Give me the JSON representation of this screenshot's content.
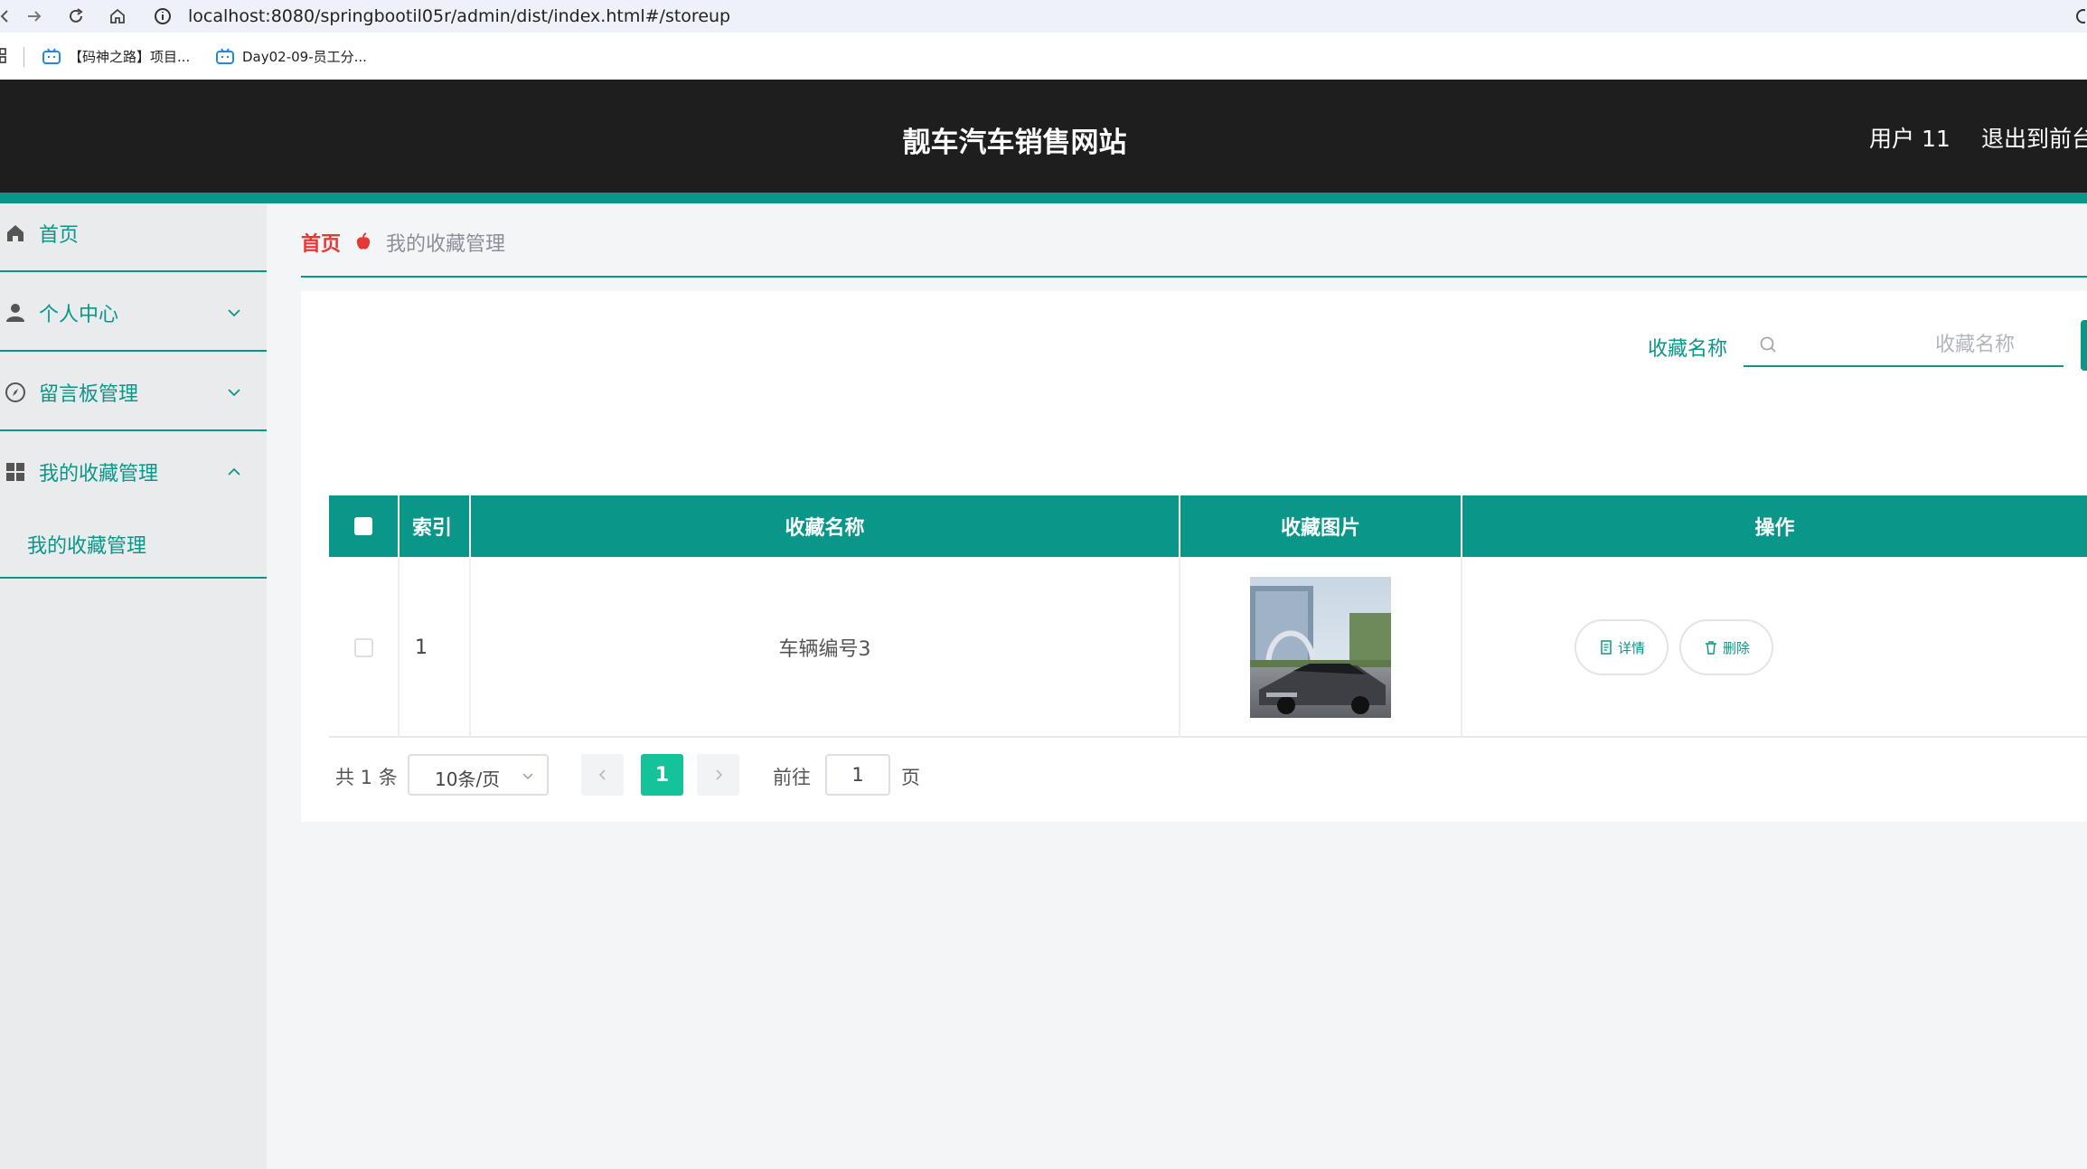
{
  "browser": {
    "url": "localhost:8080/springbootil05r/admin/dist/index.html#/storeup",
    "bookmarks": [
      {
        "label": "【码神之路】项目..."
      },
      {
        "label": "Day02-09-员工分..."
      }
    ]
  },
  "header": {
    "title": "靓车汽车销售网站",
    "user": "用户 11",
    "logout": "退出到前台"
  },
  "sidebar": {
    "items": [
      {
        "label": "首页",
        "icon": "home-icon"
      },
      {
        "label": "个人中心",
        "icon": "user-icon"
      },
      {
        "label": "留言板管理",
        "icon": "compass-icon"
      },
      {
        "label": "我的收藏管理",
        "icon": "grid-icon",
        "expanded": true,
        "children": [
          {
            "label": "我的收藏管理"
          }
        ]
      }
    ]
  },
  "breadcrumb": {
    "home": "首页",
    "current": "我的收藏管理"
  },
  "search": {
    "label": "收藏名称",
    "placeholder": "收藏名称",
    "value": ""
  },
  "table": {
    "columns": [
      "索引",
      "收藏名称",
      "收藏图片",
      "操作"
    ],
    "rows": [
      {
        "index": "1",
        "name": "车辆编号3",
        "detail_label": "详情",
        "delete_label": "删除"
      }
    ]
  },
  "pagination": {
    "total": "共 1 条",
    "page_size": "10条/页",
    "current_page": "1",
    "goto_label": "前往",
    "goto_value": "1",
    "page_unit": "页"
  },
  "colors": {
    "accent": "#0a9688",
    "header_bg": "#1e1e1e",
    "active_page": "#15c39a",
    "breadcrumb_home": "#e53935"
  }
}
